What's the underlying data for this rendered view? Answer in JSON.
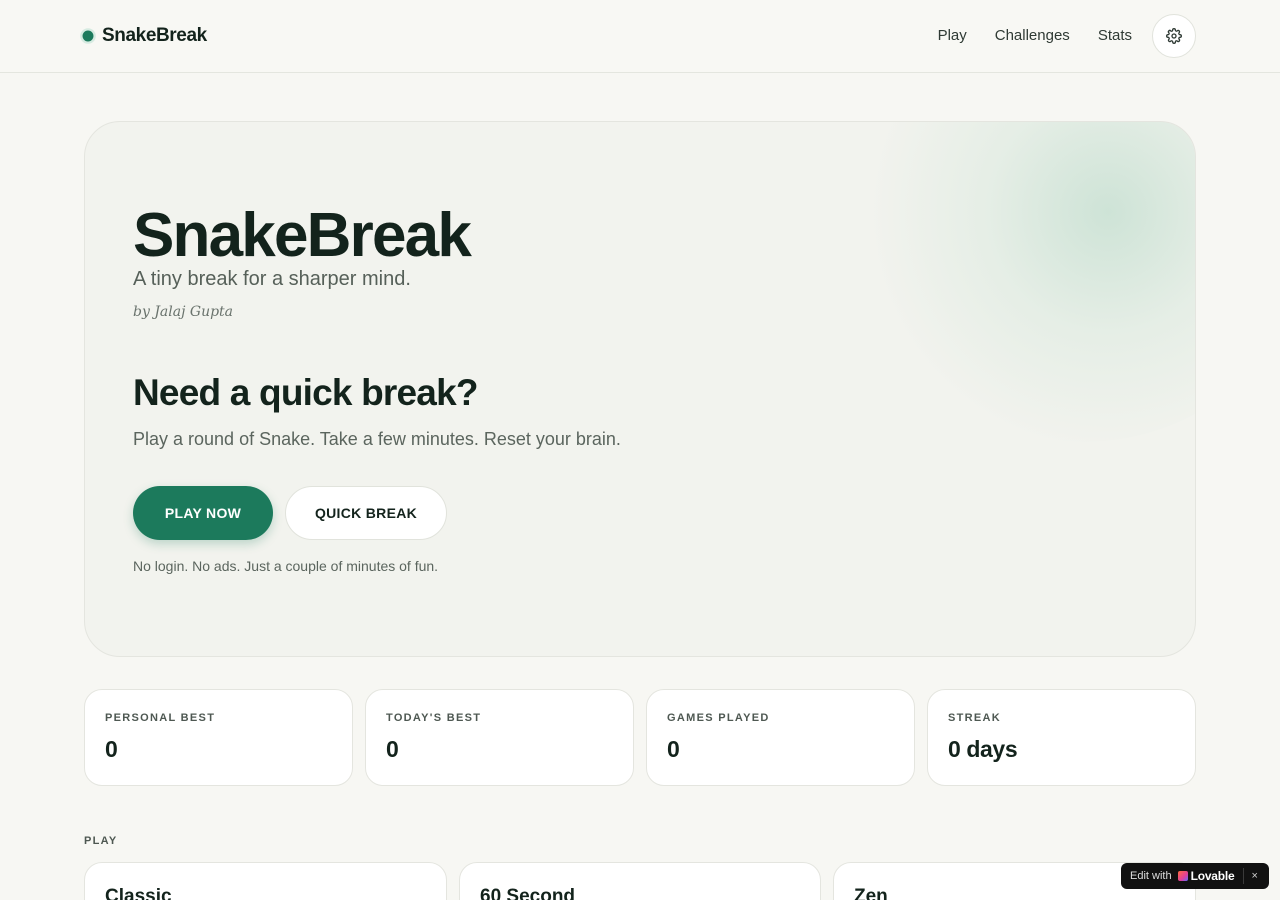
{
  "header": {
    "brand": "SnakeBreak",
    "nav": [
      "Play",
      "Challenges",
      "Stats"
    ],
    "settings_icon": "gear-icon"
  },
  "hero": {
    "title": "SnakeBreak",
    "subtitle": "A tiny break for a sharper mind.",
    "author": "by Jalaj Gupta",
    "heading": "Need a quick break?",
    "description": "Play a round of Snake. Take a few minutes. Reset your brain.",
    "primary_button": "PLAY NOW",
    "secondary_button": "QUICK BREAK",
    "note": "No login. No ads. Just a couple of minutes of fun."
  },
  "stats": [
    {
      "label": "PERSONAL BEST",
      "value": "0"
    },
    {
      "label": "TODAY'S BEST",
      "value": "0"
    },
    {
      "label": "GAMES PLAYED",
      "value": "0"
    },
    {
      "label": "STREAK",
      "value": "0 days"
    }
  ],
  "play": {
    "section_label": "PLAY",
    "modes": [
      "Classic",
      "60 Second",
      "Zen"
    ]
  },
  "badge": {
    "text": "Edit with",
    "brand": "Lovable",
    "close": "×"
  },
  "colors": {
    "accent": "#1c7a5c",
    "background": "#f7f7f3",
    "text": "#13231c"
  }
}
